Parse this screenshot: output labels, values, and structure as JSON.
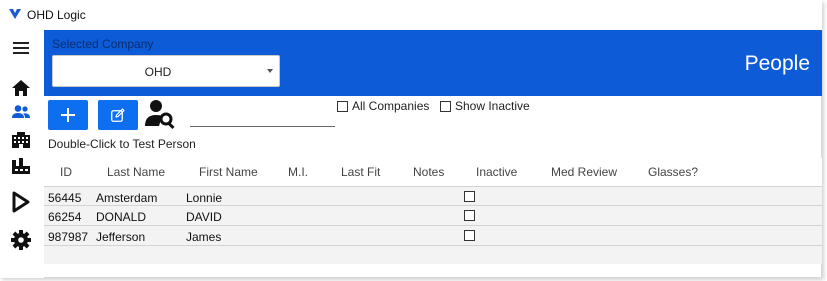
{
  "app": {
    "title": "OHD Logic",
    "brand_color": "#0d5bd7"
  },
  "sidebar": {
    "items": [
      {
        "name": "menu",
        "icon": "hamburger-menu-icon"
      },
      {
        "name": "home",
        "icon": "home-icon"
      },
      {
        "name": "people",
        "icon": "people-icon",
        "active": true
      },
      {
        "name": "companies",
        "icon": "building-icon"
      },
      {
        "name": "sites",
        "icon": "factory-icon"
      },
      {
        "name": "run-test",
        "icon": "play-icon"
      },
      {
        "name": "settings",
        "icon": "gear-icon"
      }
    ]
  },
  "header": {
    "company_label": "Selected Company",
    "company_value": "OHD",
    "page_title": "People"
  },
  "toolbar": {
    "add_icon": "plus-icon",
    "edit_icon": "edit-icon",
    "search_icon": "person-search-icon",
    "search_value": "",
    "all_companies_label": "All Companies",
    "show_inactive_label": "Show Inactive",
    "all_companies_checked": false,
    "show_inactive_checked": false
  },
  "hint": "Double-Click to Test Person",
  "table": {
    "columns": [
      "ID",
      "Last Name",
      "First Name",
      "M.I.",
      "Last Fit",
      "Notes",
      "Inactive",
      "Med Review",
      "Glasses?"
    ],
    "rows": [
      {
        "id": "56445",
        "last_name": "Amsterdam",
        "first_name": "Lonnie",
        "mi": "",
        "last_fit": "",
        "notes": "",
        "inactive": false,
        "med_review": "",
        "glasses": ""
      },
      {
        "id": "66254",
        "last_name": "DONALD",
        "first_name": "DAVID",
        "mi": "",
        "last_fit": "",
        "notes": "",
        "inactive": false,
        "med_review": "",
        "glasses": ""
      },
      {
        "id": "987987",
        "last_name": "Jefferson",
        "first_name": "James",
        "mi": "",
        "last_fit": "",
        "notes": "",
        "inactive": false,
        "med_review": "",
        "glasses": ""
      }
    ]
  }
}
